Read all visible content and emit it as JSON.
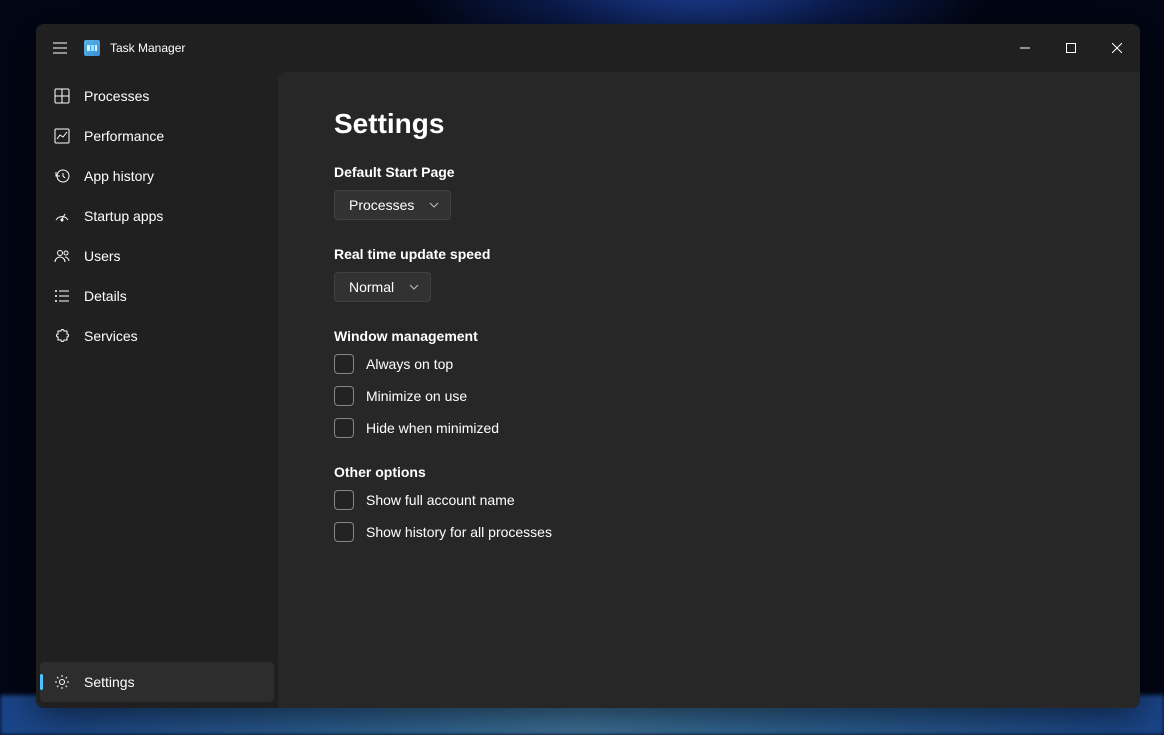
{
  "app": {
    "title": "Task Manager"
  },
  "sidebar": {
    "items": [
      {
        "label": "Processes"
      },
      {
        "label": "Performance"
      },
      {
        "label": "App history"
      },
      {
        "label": "Startup apps"
      },
      {
        "label": "Users"
      },
      {
        "label": "Details"
      },
      {
        "label": "Services"
      }
    ],
    "bottom": {
      "label": "Settings"
    }
  },
  "page": {
    "title": "Settings",
    "default_start_page": {
      "label": "Default Start Page",
      "value": "Processes"
    },
    "update_speed": {
      "label": "Real time update speed",
      "value": "Normal"
    },
    "window_management": {
      "label": "Window management",
      "options": [
        {
          "label": "Always on top",
          "checked": false
        },
        {
          "label": "Minimize on use",
          "checked": false
        },
        {
          "label": "Hide when minimized",
          "checked": false
        }
      ]
    },
    "other_options": {
      "label": "Other options",
      "options": [
        {
          "label": "Show full account name",
          "checked": false
        },
        {
          "label": "Show history for all processes",
          "checked": false
        }
      ]
    }
  }
}
